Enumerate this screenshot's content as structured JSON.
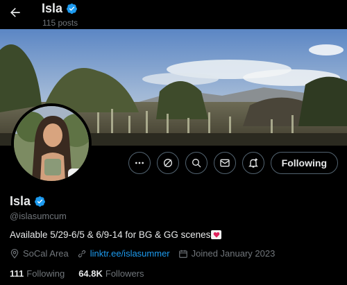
{
  "header": {
    "name": "Isla",
    "posts_count": "115 posts"
  },
  "actions": {
    "following_label": "Following"
  },
  "profile": {
    "display_name": "Isla",
    "handle": "@islasumcum",
    "bio": "Available 5/29-6/5 & 6/9-14 for BG & GG scenes",
    "location": "SoCal Area",
    "link": "linktr.ee/islasummer",
    "joined": "Joined January 2023"
  },
  "stats": {
    "following_count": "111",
    "following_label": "Following",
    "followers_count": "64.8K",
    "followers_label": "Followers"
  },
  "colors": {
    "verified": "#1d9bf0",
    "link": "#1d9bf0",
    "muted_text": "#71767b",
    "border": "#536471"
  }
}
